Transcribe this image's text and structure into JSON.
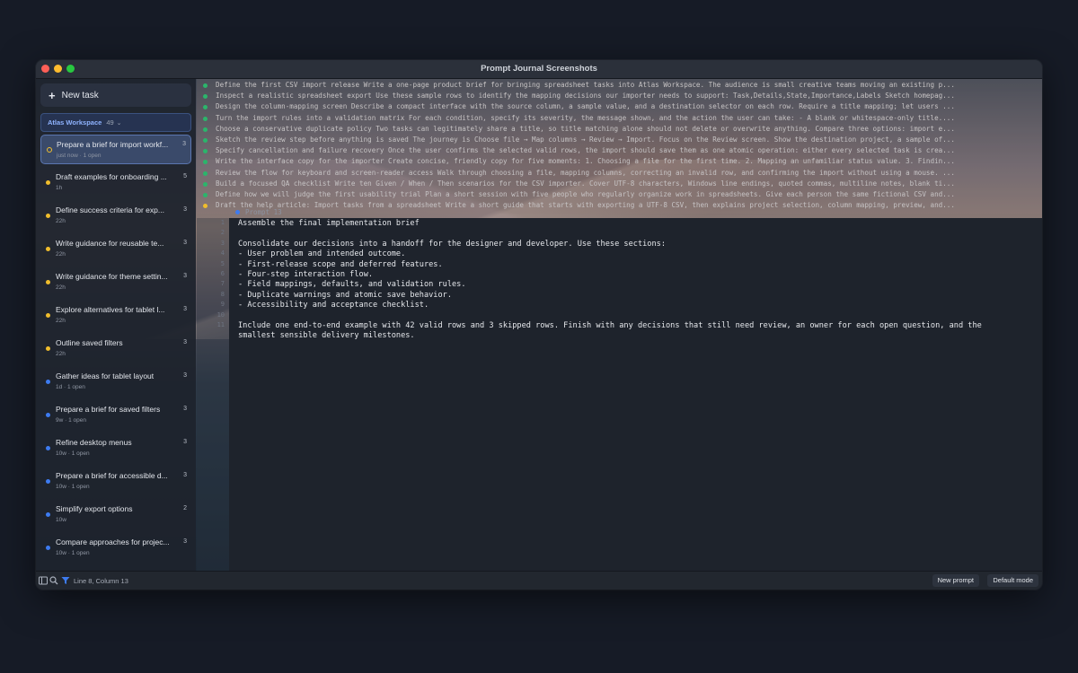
{
  "window": {
    "title": "Prompt Journal Screenshots"
  },
  "sidebar": {
    "new_task_label": "New task",
    "workspace": {
      "name": "Atlas Workspace",
      "count": "49"
    },
    "tasks": [
      {
        "title": "Prepare a brief for import workf...",
        "meta": "just now · 1 open",
        "count": "3",
        "status": "yellow",
        "active": true
      },
      {
        "title": "Draft examples for onboarding ...",
        "meta": "1h",
        "count": "5",
        "status": "yellow"
      },
      {
        "title": "Define success criteria for exp...",
        "meta": "22h",
        "count": "3",
        "status": "yellow"
      },
      {
        "title": "Write guidance for reusable te...",
        "meta": "22h",
        "count": "3",
        "status": "yellow"
      },
      {
        "title": "Write guidance for theme settin...",
        "meta": "22h",
        "count": "3",
        "status": "yellow"
      },
      {
        "title": "Explore alternatives for tablet l...",
        "meta": "22h",
        "count": "3",
        "status": "yellow"
      },
      {
        "title": "Outline saved filters",
        "meta": "22h",
        "count": "3",
        "status": "yellow"
      },
      {
        "title": "Gather ideas for tablet layout",
        "meta": "1d · 1 open",
        "count": "3",
        "status": "blue"
      },
      {
        "title": "Prepare a brief for saved filters",
        "meta": "9w · 1 open",
        "count": "3",
        "status": "blue"
      },
      {
        "title": "Refine desktop menus",
        "meta": "10w · 1 open",
        "count": "3",
        "status": "blue"
      },
      {
        "title": "Prepare a brief for accessible d...",
        "meta": "10w · 1 open",
        "count": "3",
        "status": "blue"
      },
      {
        "title": "Simplify export options",
        "meta": "10w",
        "count": "2",
        "status": "blue"
      },
      {
        "title": "Compare approaches for projec...",
        "meta": "10w · 1 open",
        "count": "3",
        "status": "blue"
      }
    ]
  },
  "prompts": [
    {
      "text": "Define the first CSV import release Write a one-page product brief for bringing spreadsheet tasks into Atlas Workspace. The audience is small creative teams moving an existing p...",
      "status": "green"
    },
    {
      "text": "Inspect a realistic spreadsheet export Use these sample rows to identify the mapping decisions our importer needs to support: Task,Details,State,Importance,Labels Sketch homepag...",
      "status": "green"
    },
    {
      "text": "Design the column-mapping screen Describe a compact interface with the source column, a sample value, and a destination selector on each row. Require a title mapping; let users ...",
      "status": "green"
    },
    {
      "text": "Turn the import rules into a validation matrix For each condition, specify its severity, the message shown, and the action the user can take: - A blank or whitespace-only title....",
      "status": "green"
    },
    {
      "text": "Choose a conservative duplicate policy Two tasks can legitimately share a title, so title matching alone should not delete or overwrite anything. Compare three options: import e...",
      "status": "green"
    },
    {
      "text": "Sketch the review step before anything is saved The journey is Choose file → Map columns → Review → Import. Focus on the Review screen. Show the destination project, a sample of...",
      "status": "green"
    },
    {
      "text": "Specify cancellation and failure recovery Once the user confirms the selected valid rows, the import should save them as one atomic operation: either every selected task is crea...",
      "status": "green"
    },
    {
      "text": "Write the interface copy for the importer Create concise, friendly copy for five moments: 1. Choosing a file for the first time. 2. Mapping an unfamiliar status value. 3. Findin...",
      "status": "green"
    },
    {
      "text": "Review the flow for keyboard and screen-reader access Walk through choosing a file, mapping columns, correcting an invalid row, and confirming the import without using a mouse. ...",
      "status": "green"
    },
    {
      "text": "Build a focused QA checklist Write ten Given / When / Then scenarios for the CSV importer. Cover UTF-8 characters, Windows line endings, quoted commas, multiline notes, blank ti...",
      "status": "green"
    },
    {
      "text": "Define how we will judge the first usability trial Plan a short session with five people who regularly organize work in spreadsheets. Give each person the same fictional CSV and...",
      "status": "green"
    },
    {
      "text": "Draft the help article: Import tasks from a spreadsheet Write a short guide that starts with exporting a UTF-8 CSV, then explains project selection, column mapping, preview, and...",
      "status": "yellow"
    }
  ],
  "editor": {
    "prompt_label": "Prompt 13",
    "line_numbers": [
      "1",
      "2",
      "3",
      "4",
      "5",
      "6",
      "7",
      "8",
      "9",
      "10",
      "11"
    ],
    "lines": [
      "Assemble the final implementation brief",
      "",
      "Consolidate our decisions into a handoff for the designer and developer. Use these sections:",
      "- User problem and intended outcome.",
      "- First-release scope and deferred features.",
      "- Four-step interaction flow.",
      "- Field mappings, defaults, and validation rules.",
      "- Duplicate warnings and atomic save behavior.",
      "- Accessibility and acceptance checklist.",
      "",
      "Include one end-to-end example with 42 valid rows and 3 skipped rows. Finish with any decisions that still need review, an owner for each open question, and the",
      "smallest sensible delivery milestones."
    ]
  },
  "statusbar": {
    "position": "Line 8, Column 13",
    "new_prompt_label": "New prompt",
    "mode_label": "Default mode"
  },
  "colors": {
    "accent": "#3d7bf0",
    "pending": "#f0bd2c",
    "done": "#2bb56b"
  }
}
